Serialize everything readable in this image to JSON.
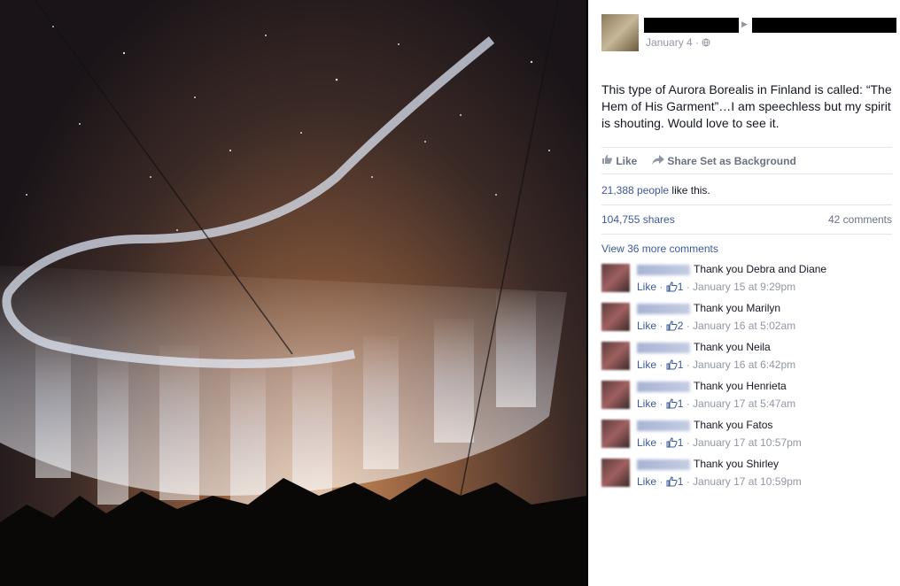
{
  "post": {
    "date": "January 4 · ",
    "message": "This type of Aurora Borealis in Finland is called: “The Hem of His Garment”…I am speechless but my spirit is shouting. Would love to see it.",
    "actions": {
      "like": "Like",
      "share": "Share",
      "set_bg": "Set as Background"
    },
    "likes_count": "21,388 people",
    "likes_suffix": " like this.",
    "shares": "104,755 shares",
    "comments_count": "42 comments",
    "view_more": "View 36 more comments"
  },
  "comments": [
    {
      "text": "Thank you Debra and Diane",
      "like": "Like",
      "count": "1",
      "time": "January 15 at 9:29pm"
    },
    {
      "text": "Thank you Marilyn",
      "like": "Like",
      "count": "2",
      "time": "January 16 at 5:02am"
    },
    {
      "text": "Thank you Neila",
      "like": "Like",
      "count": "1",
      "time": "January 16 at 6:42pm"
    },
    {
      "text": "Thank you Henrieta",
      "like": "Like",
      "count": "1",
      "time": "January 17 at 5:47am"
    },
    {
      "text": "Thank you Fatos",
      "like": "Like",
      "count": "1",
      "time": "January 17 at 10:57pm"
    },
    {
      "text": "Thank you Shirley",
      "like": "Like",
      "count": "1",
      "time": "January 17 at 10:59pm"
    }
  ],
  "colors": {
    "link": "#3b5998",
    "meta": "#9197a3"
  },
  "icons": [
    "globe-icon",
    "like-thumb-icon",
    "share-arrow-icon"
  ]
}
